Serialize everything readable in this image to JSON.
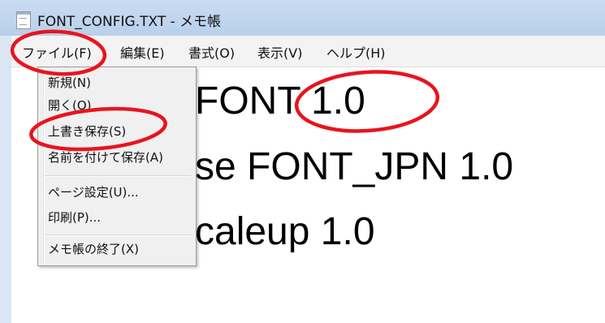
{
  "window": {
    "title": "FONT_CONFIG.TXT - メモ帳"
  },
  "menubar": {
    "items": [
      {
        "label": "ファイル(F)"
      },
      {
        "label": "編集(E)"
      },
      {
        "label": "書式(O)"
      },
      {
        "label": "表示(V)"
      },
      {
        "label": "ヘルプ(H)"
      }
    ]
  },
  "file_menu": {
    "items": [
      {
        "label": "新規(N)"
      },
      {
        "label": "開く(O)"
      },
      {
        "label": "上書き保存(S)"
      },
      {
        "label": "名前を付けて保存(A)"
      },
      {
        "label": "ページ設定(U)..."
      },
      {
        "label": "印刷(P)..."
      },
      {
        "label": "メモ帳の終了(X)"
      }
    ]
  },
  "editor": {
    "lines": [
      "FONT 1.0",
      "se FONT_JPN 1.0",
      "caleup 1.0"
    ]
  },
  "annotations": {
    "color": "#e8141e"
  },
  "icons": {
    "app": "notepad-icon"
  }
}
